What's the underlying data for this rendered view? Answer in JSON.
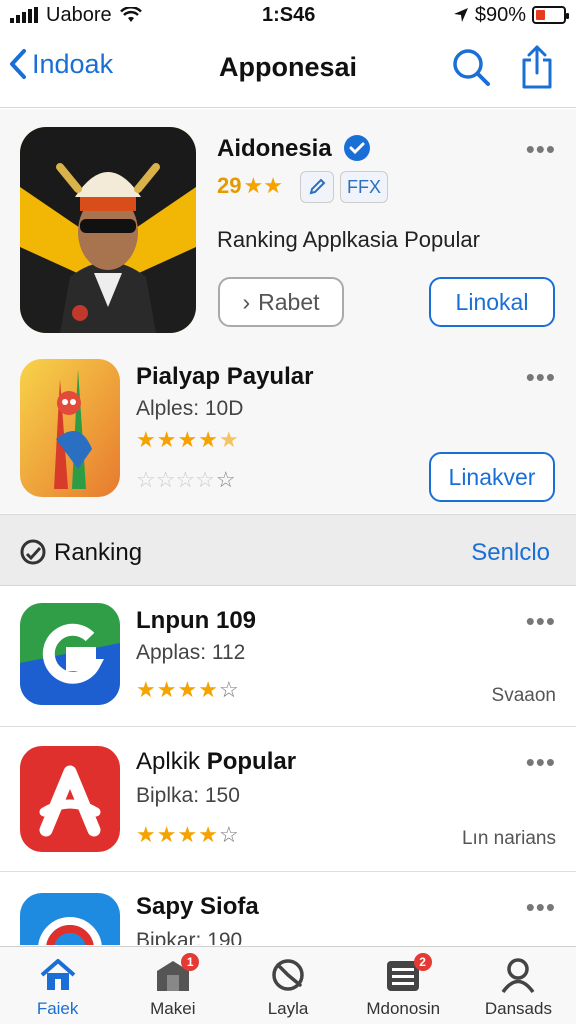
{
  "status_bar": {
    "carrier": "Uabore",
    "time": "1:S46",
    "battery_text": "$90%",
    "battery_level": 0.35
  },
  "nav": {
    "back_label": "Indoak",
    "title": "Apponesai"
  },
  "featured": {
    "app_name": "Aidonesia",
    "rating_text": "29",
    "chip_label": "FFX",
    "tagline": "Ranking Applkasia Popular",
    "left_button": "Rabet",
    "right_button": "Linokal"
  },
  "second_app": {
    "name": "Pialyap Payular",
    "sub": "Alples: 10D",
    "stars": 4.5,
    "button": "Linakver"
  },
  "ranking_header": {
    "title": "Ranking",
    "link": "Senlclo"
  },
  "ranking_list": [
    {
      "name": "Lnpun 109",
      "sub": "Applas: 112",
      "stars": 4,
      "meta": "Svaaon"
    },
    {
      "name_prefix": "Aplkik",
      "name_bold": "Popular",
      "sub": "Biplka: 150",
      "stars": 4,
      "meta": "Lın narians"
    },
    {
      "name": "Sapy Siofa",
      "sub": "Bipkar: 190"
    }
  ],
  "tab_bar": {
    "tabs": [
      {
        "label": "Faiek",
        "icon": "home-icon",
        "active": true
      },
      {
        "label": "Makei",
        "icon": "store-icon",
        "badge": "1"
      },
      {
        "label": "Layla",
        "icon": "chart-icon"
      },
      {
        "label": "Mdonosin",
        "icon": "list-icon",
        "badge": "2"
      },
      {
        "label": "Dansads",
        "icon": "person-icon"
      }
    ]
  },
  "colors": {
    "accent": "#1a6fd6",
    "star": "#f4a300",
    "badge": "#e53935"
  }
}
